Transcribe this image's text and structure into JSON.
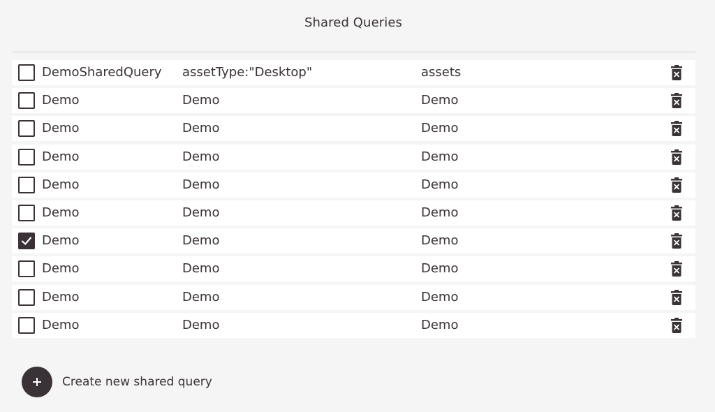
{
  "page": {
    "title": "Shared Queries"
  },
  "colors": {
    "background": "#f5f5f5",
    "row_background": "#ffffff",
    "text": "#3a3236",
    "accent": "#3a3236",
    "divider": "#cfcfcf"
  },
  "icons": {
    "checkbox_checked": "check-icon",
    "delete": "trash-icon",
    "create": "plus-icon"
  },
  "queries": [
    {
      "name": "DemoSharedQuery",
      "query": "assetType:\"Desktop\"",
      "type": "assets",
      "checked": false
    },
    {
      "name": "Demo",
      "query": "Demo",
      "type": "Demo",
      "checked": false
    },
    {
      "name": "Demo",
      "query": "Demo",
      "type": "Demo",
      "checked": false
    },
    {
      "name": "Demo",
      "query": "Demo",
      "type": "Demo",
      "checked": false
    },
    {
      "name": "Demo",
      "query": "Demo",
      "type": "Demo",
      "checked": false
    },
    {
      "name": "Demo",
      "query": "Demo",
      "type": "Demo",
      "checked": false
    },
    {
      "name": "Demo",
      "query": "Demo",
      "type": "Demo",
      "checked": true
    },
    {
      "name": "Demo",
      "query": "Demo",
      "type": "Demo",
      "checked": false
    },
    {
      "name": "Demo",
      "query": "Demo",
      "type": "Demo",
      "checked": false
    },
    {
      "name": "Demo",
      "query": "Demo",
      "type": "Demo",
      "checked": false
    }
  ],
  "create": {
    "label": "Create new shared query"
  }
}
